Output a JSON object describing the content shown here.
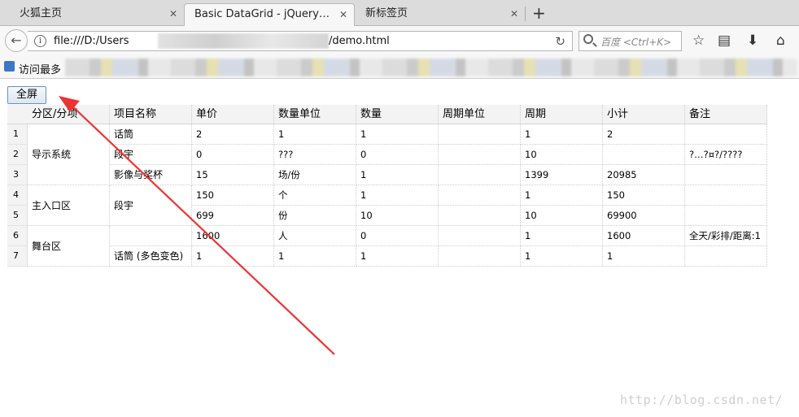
{
  "browser": {
    "tabs": [
      {
        "label": "火狐主页"
      },
      {
        "label": "Basic DataGrid - jQuery EasyUI Demo"
      },
      {
        "label": "新标签页"
      }
    ],
    "new_tab_glyph": "+",
    "close_glyph": "✕",
    "url_prefix": "file:///D:/Users",
    "url_suffix": "/demo.html",
    "search_placeholder": "百度 <Ctrl+K>",
    "bookmarks_label": "访问最多"
  },
  "page": {
    "fullscreen_label": "全屏",
    "grid": {
      "headers": [
        "分区/分项",
        "项目名称",
        "单价",
        "数量单位",
        "数量",
        "周期单位",
        "周期",
        "小计",
        "备注"
      ],
      "row_numbers": [
        "1",
        "2",
        "3",
        "4",
        "5",
        "6",
        "7"
      ],
      "merged_zones": [
        {
          "label": "导示系统",
          "rows": [
            1,
            3
          ]
        },
        {
          "label": "主入口区",
          "rows": [
            4,
            5
          ]
        },
        {
          "label": "舞台区",
          "rows": [
            6,
            7
          ]
        }
      ],
      "item_names": [
        {
          "label": "话筒",
          "rows": [
            1,
            1
          ]
        },
        {
          "label": "段宇",
          "rows": [
            2,
            2
          ]
        },
        {
          "label": "影像与奖杯",
          "rows": [
            3,
            3
          ]
        },
        {
          "label": "段宇",
          "rows": [
            4,
            5
          ]
        },
        {
          "label": "",
          "rows": [
            6,
            6
          ]
        },
        {
          "label": "话筒 (多色变色)",
          "rows": [
            7,
            7
          ]
        }
      ],
      "rows": [
        [
          "2",
          "1",
          "1",
          "",
          "1",
          "2",
          ""
        ],
        [
          "0",
          "???",
          "0",
          "",
          "10",
          "",
          "?…?¤?/????"
        ],
        [
          "15",
          "场/份",
          "1",
          "",
          "1399",
          "20985",
          ""
        ],
        [
          "150",
          "个",
          "1",
          "",
          "1",
          "150",
          ""
        ],
        [
          "699",
          "份",
          "10",
          "",
          "10",
          "69900",
          ""
        ],
        [
          "1600",
          "人",
          "0",
          "",
          "1",
          "1600",
          "全天/彩排/距离:1"
        ],
        [
          "1",
          "1",
          "1",
          "",
          "1",
          "1",
          ""
        ]
      ]
    }
  },
  "watermark": "http://blog.csdn.net/",
  "colors": {
    "annotation_arrow": "#ee3333",
    "grid_header_bg": "#f3f3f3",
    "button_border": "#6f8fb3"
  }
}
